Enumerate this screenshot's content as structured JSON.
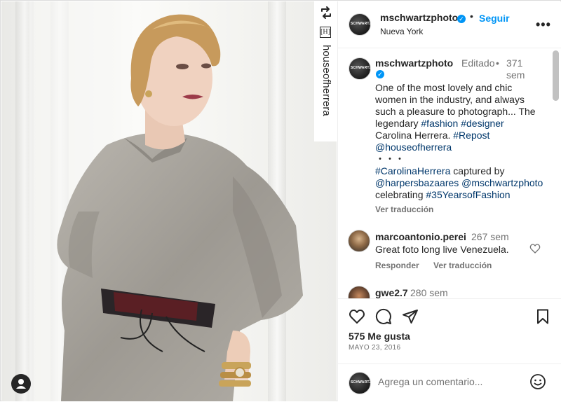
{
  "photo": {
    "vertical_handle": "houseofherrera",
    "brand_mark": "[H]"
  },
  "header": {
    "username": "mschwartzphoto",
    "verified_glyph": "✓",
    "separator": "•",
    "follow_label": "Seguir",
    "location": "Nueva York",
    "more_label": "•••",
    "avatar_text": "SCHWARTZ"
  },
  "caption": {
    "username": "mschwartzphoto",
    "edited": "Editado",
    "separator": "•",
    "time": "371 sem",
    "lines": [
      [
        {
          "t": "One of the most lovely and chic",
          "k": "text"
        }
      ],
      [
        {
          "t": "women in the industry, and always",
          "k": "text"
        }
      ],
      [
        {
          "t": "such a pleasure to photograph... The",
          "k": "text"
        }
      ],
      [
        {
          "t": "legendary ",
          "k": "text"
        },
        {
          "t": "#fashion",
          "k": "tag"
        },
        {
          "t": " ",
          "k": "text"
        },
        {
          "t": "#designer",
          "k": "tag"
        }
      ],
      [
        {
          "t": "Carolina Herrera. ",
          "k": "text"
        },
        {
          "t": "#Repost",
          "k": "tag"
        }
      ],
      [
        {
          "t": "@houseofherrera",
          "k": "tag"
        }
      ],
      [
        {
          "t": "・・・",
          "k": "text"
        }
      ],
      [
        {
          "t": "#CarolinaHerrera",
          "k": "tag"
        },
        {
          "t": " captured by",
          "k": "text"
        }
      ],
      [
        {
          "t": "@harpersbazaares",
          "k": "tag"
        },
        {
          "t": " ",
          "k": "text"
        },
        {
          "t": "@mschwartzphoto",
          "k": "tag"
        }
      ],
      [
        {
          "t": "celebrating ",
          "k": "text"
        },
        {
          "t": "#35YearsofFashion",
          "k": "tag"
        }
      ]
    ],
    "translate_label": "Ver traducción"
  },
  "comments": [
    {
      "username": "marcoantonio.perei",
      "time": "267 sem",
      "text": "Great foto long live Venezuela.",
      "reply_label": "Responder",
      "translate_label": "Ver traducción"
    },
    {
      "username": "gwe2.7",
      "time": "280 sem"
    }
  ],
  "actions": {
    "likes": "575 Me gusta",
    "date": "MAYO 23, 2016"
  },
  "comment_box": {
    "placeholder": "Agrega un comentario..."
  },
  "icons": {
    "repost": "repost-icon",
    "brand": "brand-icon",
    "user_tag": "user-tag-icon",
    "more": "more-options-icon",
    "heart": "heart-icon",
    "comment": "comment-icon",
    "share": "share-icon",
    "save": "bookmark-icon",
    "emoji": "emoji-icon"
  },
  "colors": {
    "accent": "#0095f6",
    "link": "#00376b",
    "secondary_text": "#737373",
    "primary_text": "#262626"
  }
}
